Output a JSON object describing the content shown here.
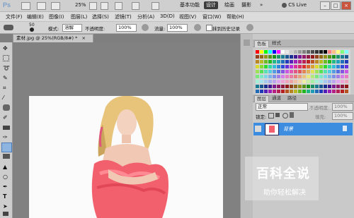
{
  "app": {
    "logo": "Ps",
    "zoom": "25%",
    "workspaces": [
      "基本功能",
      "设计",
      "绘画",
      "摄影"
    ],
    "active_workspace": "设计",
    "more": "»",
    "cs_live": "CS Live",
    "window_buttons": [
      "–",
      "□",
      "×"
    ]
  },
  "menu": [
    "文件(F)",
    "编辑(E)",
    "图像(I)",
    "图层(L)",
    "选择(S)",
    "滤镜(T)",
    "分析(A)",
    "3D(D)",
    "视图(V)",
    "窗口(W)",
    "帮助(H)"
  ],
  "options": {
    "brush_size": "50",
    "mode_label": "模式:",
    "mode_value": "溶解",
    "opacity_label": "不透明度:",
    "opacity_value": "100%",
    "flow_label": "流量:",
    "flow_value": "100%",
    "history_label": "抹到历史记录"
  },
  "document": {
    "tab_title": "素材.jpg @ 25%(RGB/8#) *",
    "tab_close": "×"
  },
  "swatches_panel": {
    "tabs": [
      "色板",
      "样式"
    ],
    "active_tab": "色板"
  },
  "layers_panel": {
    "tabs": [
      "图层",
      "通道",
      "路径"
    ],
    "active_tab": "图层",
    "blend_mode": "正常",
    "opacity_label": "不透明度:",
    "opacity_value": "100%",
    "lock_label": "锁定:",
    "fill_label": "填充:",
    "fill_value": "100%",
    "layer_name": "背景"
  },
  "watermark": {
    "title": "百科全说",
    "subtitle": "助你轻松解决"
  },
  "colors": {
    "accent": "#3c8ce0",
    "photo_dress": "#f2606d",
    "photo_hair": "#e8c47a"
  }
}
